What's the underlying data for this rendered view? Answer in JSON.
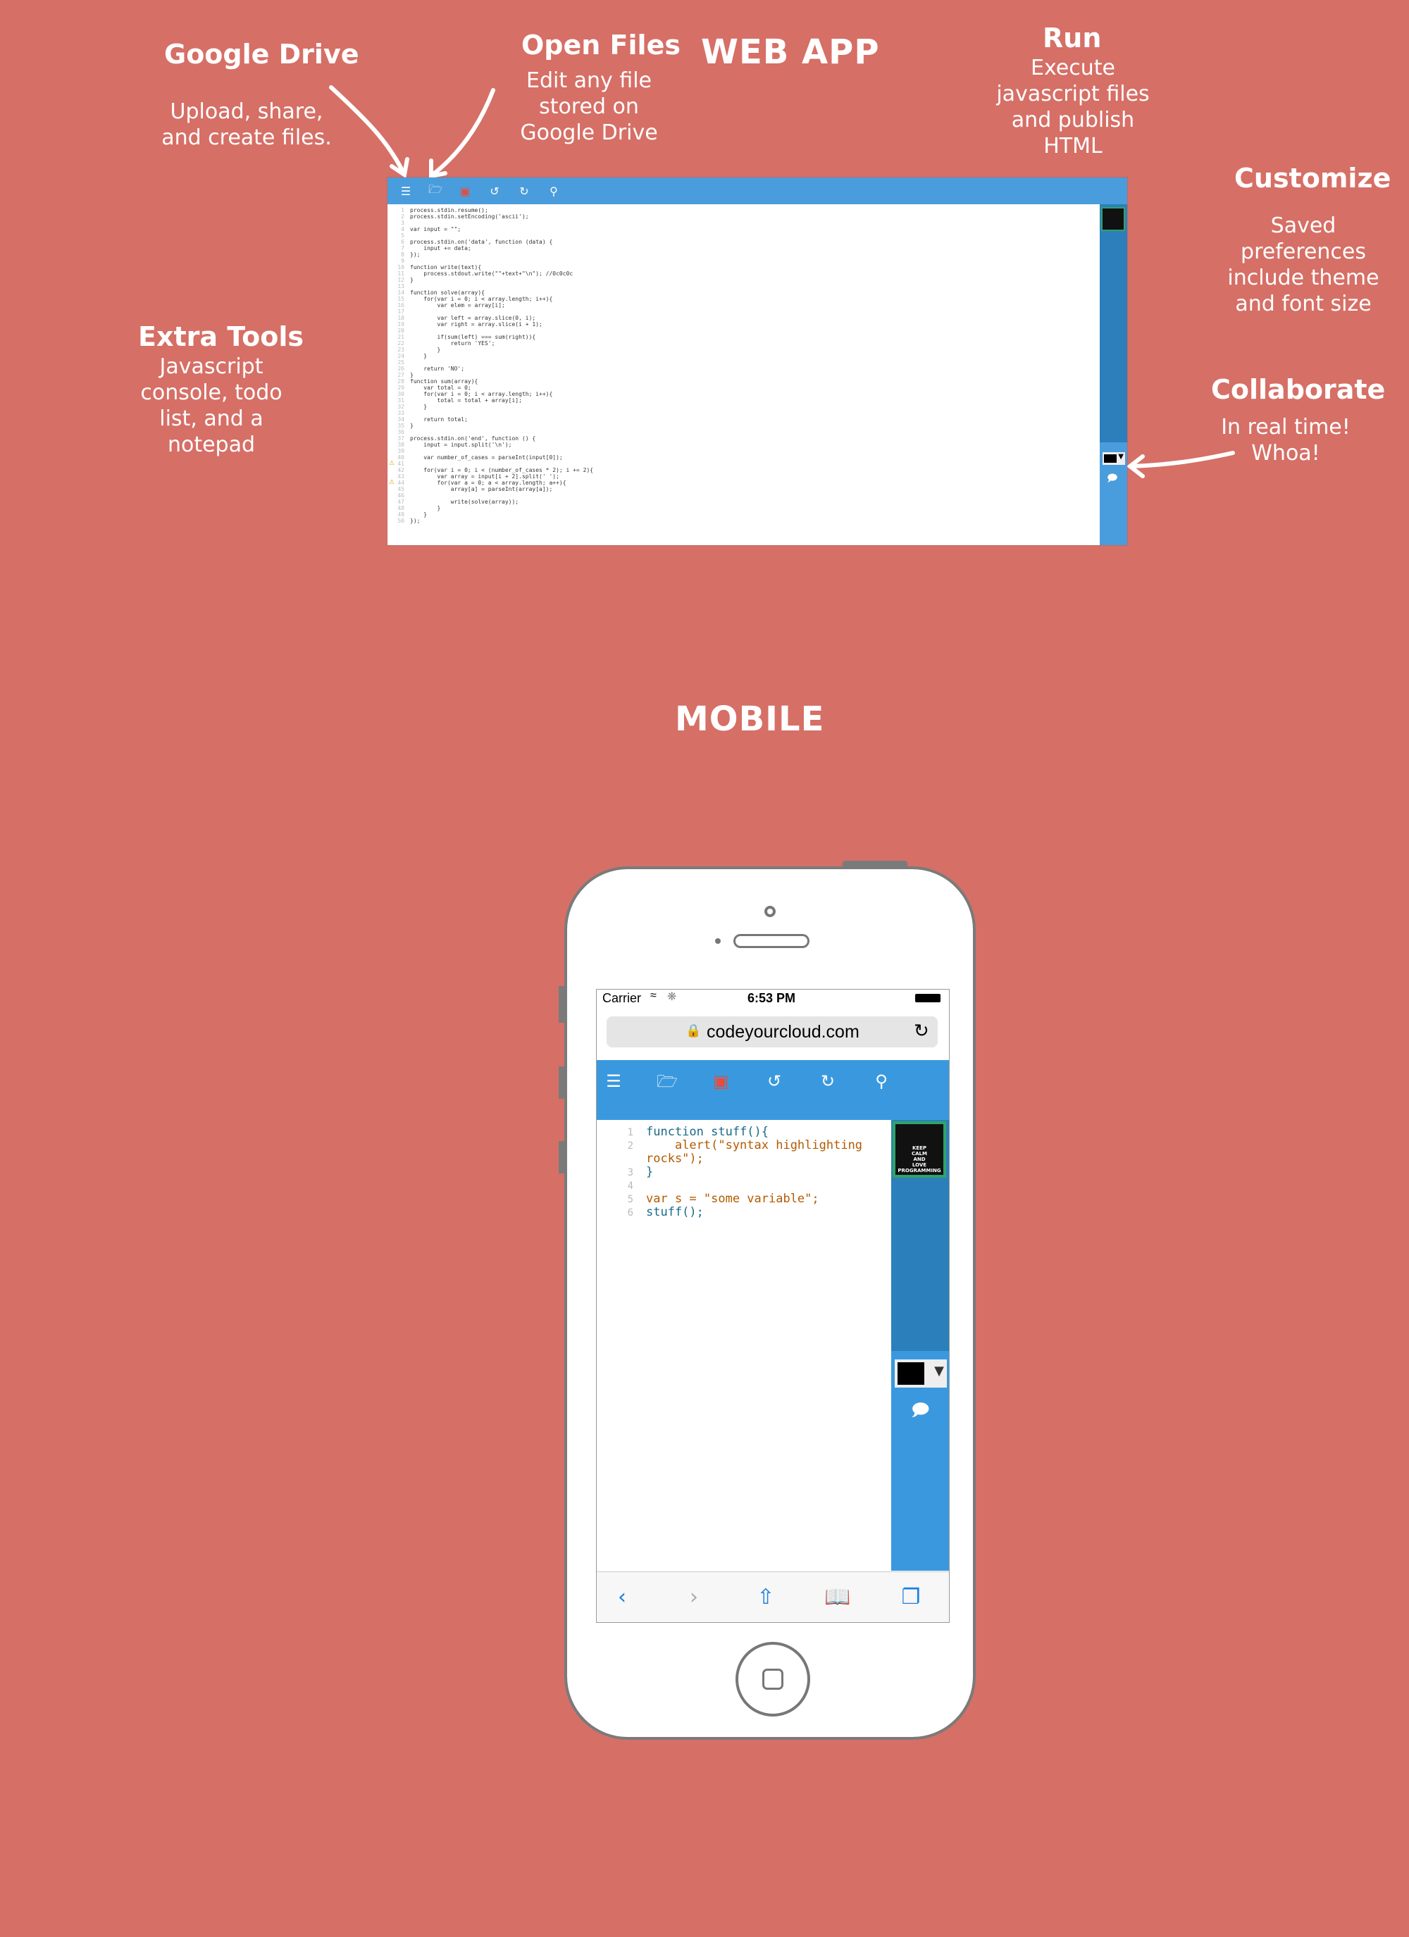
{
  "page": {
    "web_title": "WEB APP",
    "mobile_title": "MOBILE"
  },
  "annotations": {
    "google_drive": {
      "heading": "Google Drive",
      "text": "Upload, share,\nand create files."
    },
    "open_files": {
      "heading": "Open Files",
      "text": "Edit any file\nstored on\nGoogle Drive"
    },
    "run": {
      "heading": "Run",
      "text": "Execute\njavascript files\nand publish\nHTML"
    },
    "customize": {
      "heading": "Customize",
      "text": "Saved\npreferences\ninclude theme\nand font size"
    },
    "extra_tools": {
      "heading": "Extra Tools",
      "text": "Javascript\nconsole, todo\nlist, and a\nnotepad"
    },
    "collaborate": {
      "heading": "Collaborate",
      "text": "In real time!\nWhoa!"
    }
  },
  "icons": {
    "menu": "menu-icon",
    "open": "folder-open-icon",
    "save": "save-icon",
    "undo": "undo-icon",
    "redo": "redo-icon",
    "search": "search-icon",
    "chat": "chat-icon",
    "back": "back-icon",
    "forward": "forward-icon",
    "share": "share-icon",
    "bookmarks": "bookmarks-icon",
    "tabs": "tabs-icon"
  },
  "colors": {
    "background": "#d66f66",
    "toolbar": "#3a99de",
    "sidebar_dark": "#2b7fba",
    "save_icon": "#e74c3c"
  },
  "web_editor": {
    "lines": [
      "process.stdin.resume();",
      "process.stdin.setEncoding('ascii');",
      "",
      "var input = \"\";",
      "",
      "process.stdin.on('data', function (data) {",
      "    input += data;",
      "});",
      "",
      "function write(text){",
      "    process.stdout.write(\"\"+text+\"\\n\"); //0c0c0c",
      "}",
      "",
      "function solve(array){",
      "    for(var i = 0; i < array.length; i++){",
      "        var elem = array[i];",
      "",
      "        var left = array.slice(0, i);",
      "        var right = array.slice(i + 1);",
      "",
      "        if(sum(left) === sum(right)){",
      "            return 'YES';",
      "        }",
      "    }",
      "",
      "    return 'NO';",
      "}",
      "function sum(array){",
      "    var total = 0;",
      "    for(var i = 0; i < array.length; i++){",
      "        total = total + array[i];",
      "    }",
      "",
      "    return total;",
      "}",
      "",
      "process.stdin.on('end', function () {",
      "    input = input.split('\\n');",
      "",
      "    var number_of_cases = parseInt(input[0]);",
      "",
      "    for(var i = 0; i < (number_of_cases * 2); i += 2){",
      "        var array = input[i + 2].split(' ');",
      "        for(var a = 0; a < array.length; a++){",
      "            array[a] = parseInt(array[a]);",
      "",
      "            write(solve(array));",
      "        }",
      "    }",
      "});"
    ]
  },
  "phone": {
    "status": {
      "carrier": "Carrier",
      "time": "6:53 PM"
    },
    "url": "codeyourcloud.com",
    "code_lines": [
      {
        "num": "1",
        "text": "function stuff(){"
      },
      {
        "num": "2",
        "text": "    alert(\"syntax highlighting"
      },
      {
        "num": "",
        "text": "rocks\");"
      },
      {
        "num": "3",
        "text": "}"
      },
      {
        "num": "4",
        "text": ""
      },
      {
        "num": "5",
        "text": "var s = \"some variable\";"
      },
      {
        "num": "6",
        "text": "stuff();"
      }
    ],
    "poster_text": "KEEP\nCALM\nAND\nLOVE\nPROGRAMMING"
  }
}
